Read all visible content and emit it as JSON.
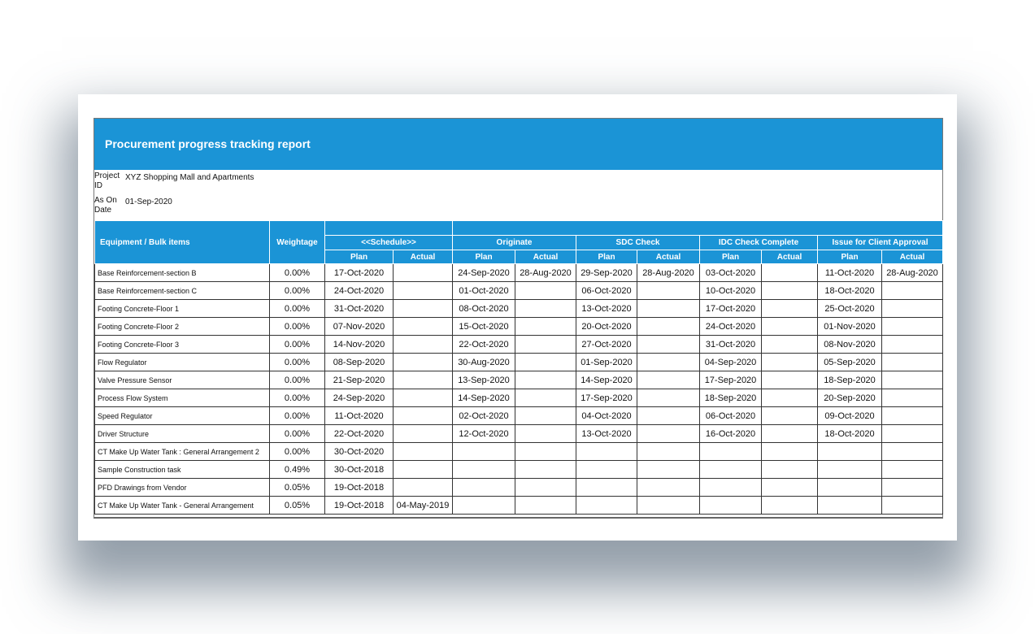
{
  "report": {
    "title": "Procurement progress tracking report",
    "project_label": "Project ID",
    "project_value": "XYZ Shopping Mall and Apartments",
    "date_label": "As On Date",
    "date_value": "01-Sep-2020"
  },
  "headers": {
    "equipment": "Equipment / Bulk items",
    "weightage": "Weightage",
    "schedule": "<<Schedule>>",
    "originate": "Originate",
    "sdc": "SDC Check",
    "idc": "IDC Check Complete",
    "issue": "Issue for Client Approval",
    "plan": "Plan",
    "actual": "Actual"
  },
  "rows": [
    {
      "item": "Base Reinforcement-section B",
      "weightage": "0.00%",
      "sched_plan": "17-Oct-2020",
      "sched_actual": "",
      "orig_plan": "24-Sep-2020",
      "orig_actual": "28-Aug-2020",
      "sdc_plan": "29-Sep-2020",
      "sdc_actual": "28-Aug-2020",
      "idc_plan": "03-Oct-2020",
      "idc_actual": "",
      "issue_plan": "11-Oct-2020",
      "issue_actual": "28-Aug-2020"
    },
    {
      "item": "Base Reinforcement-section C",
      "weightage": "0.00%",
      "sched_plan": "24-Oct-2020",
      "sched_actual": "",
      "orig_plan": "01-Oct-2020",
      "orig_actual": "",
      "sdc_plan": "06-Oct-2020",
      "sdc_actual": "",
      "idc_plan": "10-Oct-2020",
      "idc_actual": "",
      "issue_plan": "18-Oct-2020",
      "issue_actual": ""
    },
    {
      "item": "Footing Concrete-Floor 1",
      "weightage": "0.00%",
      "sched_plan": "31-Oct-2020",
      "sched_actual": "",
      "orig_plan": "08-Oct-2020",
      "orig_actual": "",
      "sdc_plan": "13-Oct-2020",
      "sdc_actual": "",
      "idc_plan": "17-Oct-2020",
      "idc_actual": "",
      "issue_plan": "25-Oct-2020",
      "issue_actual": ""
    },
    {
      "item": "Footing Concrete-Floor 2",
      "weightage": "0.00%",
      "sched_plan": "07-Nov-2020",
      "sched_actual": "",
      "orig_plan": "15-Oct-2020",
      "orig_actual": "",
      "sdc_plan": "20-Oct-2020",
      "sdc_actual": "",
      "idc_plan": "24-Oct-2020",
      "idc_actual": "",
      "issue_plan": "01-Nov-2020",
      "issue_actual": ""
    },
    {
      "item": "Footing Concrete-Floor 3",
      "weightage": "0.00%",
      "sched_plan": "14-Nov-2020",
      "sched_actual": "",
      "orig_plan": "22-Oct-2020",
      "orig_actual": "",
      "sdc_plan": "27-Oct-2020",
      "sdc_actual": "",
      "idc_plan": "31-Oct-2020",
      "idc_actual": "",
      "issue_plan": "08-Nov-2020",
      "issue_actual": ""
    },
    {
      "item": "Flow Regulator",
      "weightage": "0.00%",
      "sched_plan": "08-Sep-2020",
      "sched_actual": "",
      "orig_plan": "30-Aug-2020",
      "orig_actual": "",
      "sdc_plan": "01-Sep-2020",
      "sdc_actual": "",
      "idc_plan": "04-Sep-2020",
      "idc_actual": "",
      "issue_plan": "05-Sep-2020",
      "issue_actual": ""
    },
    {
      "item": "Valve Pressure Sensor",
      "weightage": "0.00%",
      "sched_plan": "21-Sep-2020",
      "sched_actual": "",
      "orig_plan": "13-Sep-2020",
      "orig_actual": "",
      "sdc_plan": "14-Sep-2020",
      "sdc_actual": "",
      "idc_plan": "17-Sep-2020",
      "idc_actual": "",
      "issue_plan": "18-Sep-2020",
      "issue_actual": ""
    },
    {
      "item": "Process Flow System",
      "weightage": "0.00%",
      "sched_plan": "24-Sep-2020",
      "sched_actual": "",
      "orig_plan": "14-Sep-2020",
      "orig_actual": "",
      "sdc_plan": "17-Sep-2020",
      "sdc_actual": "",
      "idc_plan": "18-Sep-2020",
      "idc_actual": "",
      "issue_plan": "20-Sep-2020",
      "issue_actual": ""
    },
    {
      "item": "Speed Regulator",
      "weightage": "0.00%",
      "sched_plan": "11-Oct-2020",
      "sched_actual": "",
      "orig_plan": "02-Oct-2020",
      "orig_actual": "",
      "sdc_plan": "04-Oct-2020",
      "sdc_actual": "",
      "idc_plan": "06-Oct-2020",
      "idc_actual": "",
      "issue_plan": "09-Oct-2020",
      "issue_actual": ""
    },
    {
      "item": "Driver Structure",
      "weightage": "0.00%",
      "sched_plan": "22-Oct-2020",
      "sched_actual": "",
      "orig_plan": "12-Oct-2020",
      "orig_actual": "",
      "sdc_plan": "13-Oct-2020",
      "sdc_actual": "",
      "idc_plan": "16-Oct-2020",
      "idc_actual": "",
      "issue_plan": "18-Oct-2020",
      "issue_actual": ""
    },
    {
      "item": "CT Make Up Water Tank : General Arrangement 2",
      "weightage": "0.00%",
      "sched_plan": "30-Oct-2020",
      "sched_actual": "",
      "orig_plan": "",
      "orig_actual": "",
      "sdc_plan": "",
      "sdc_actual": "",
      "idc_plan": "",
      "idc_actual": "",
      "issue_plan": "",
      "issue_actual": ""
    },
    {
      "item": "Sample Construction task",
      "weightage": "0.49%",
      "sched_plan": "30-Oct-2018",
      "sched_actual": "",
      "orig_plan": "",
      "orig_actual": "",
      "sdc_plan": "",
      "sdc_actual": "",
      "idc_plan": "",
      "idc_actual": "",
      "issue_plan": "",
      "issue_actual": ""
    },
    {
      "item": "PFD Drawings from Vendor",
      "weightage": "0.05%",
      "sched_plan": "19-Oct-2018",
      "sched_actual": "",
      "orig_plan": "",
      "orig_actual": "",
      "sdc_plan": "",
      "sdc_actual": "",
      "idc_plan": "",
      "idc_actual": "",
      "issue_plan": "",
      "issue_actual": ""
    },
    {
      "item": "CT Make Up Water Tank - General Arrangement",
      "weightage": "0.05%",
      "sched_plan": "19-Oct-2018",
      "sched_actual": "04-May-2019",
      "orig_plan": "",
      "orig_actual": "",
      "sdc_plan": "",
      "sdc_actual": "",
      "idc_plan": "",
      "idc_actual": "",
      "issue_plan": "",
      "issue_actual": ""
    }
  ]
}
